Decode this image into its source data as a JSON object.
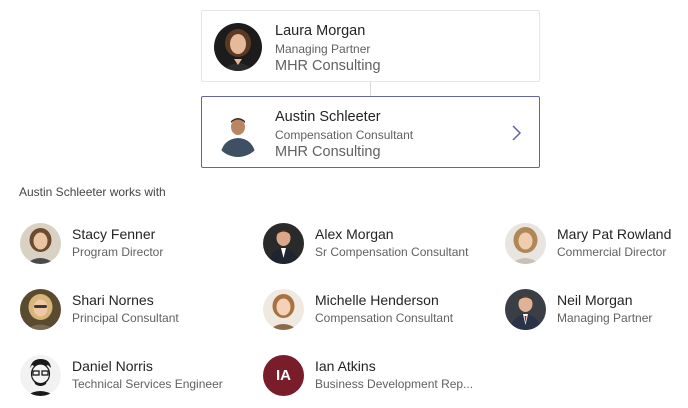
{
  "manager": {
    "name": "Laura Morgan",
    "title": "Managing Partner",
    "company": "MHR Consulting"
  },
  "selected": {
    "name": "Austin Schleeter",
    "title": "Compensation Consultant",
    "company": "MHR Consulting"
  },
  "works_with_label": "Austin Schleeter works with",
  "colleagues": [
    {
      "name": "Stacy Fenner",
      "title": "Program Director"
    },
    {
      "name": "Alex Morgan",
      "title": "Sr Compensation Consultant"
    },
    {
      "name": "Mary Pat Rowland",
      "title": "Commercial Director"
    },
    {
      "name": "Shari Nornes",
      "title": "Principal Consultant"
    },
    {
      "name": "Michelle Henderson",
      "title": "Compensation Consultant"
    },
    {
      "name": "Neil Morgan",
      "title": "Managing Partner"
    },
    {
      "name": "Daniel Norris",
      "title": "Technical Services Engineer"
    },
    {
      "name": "Ian Atkins",
      "title": "Business Development Rep...",
      "initials": "IA"
    }
  ],
  "colors": {
    "accent": "#6264a7",
    "initials_avatar": "#7a1d2b"
  }
}
